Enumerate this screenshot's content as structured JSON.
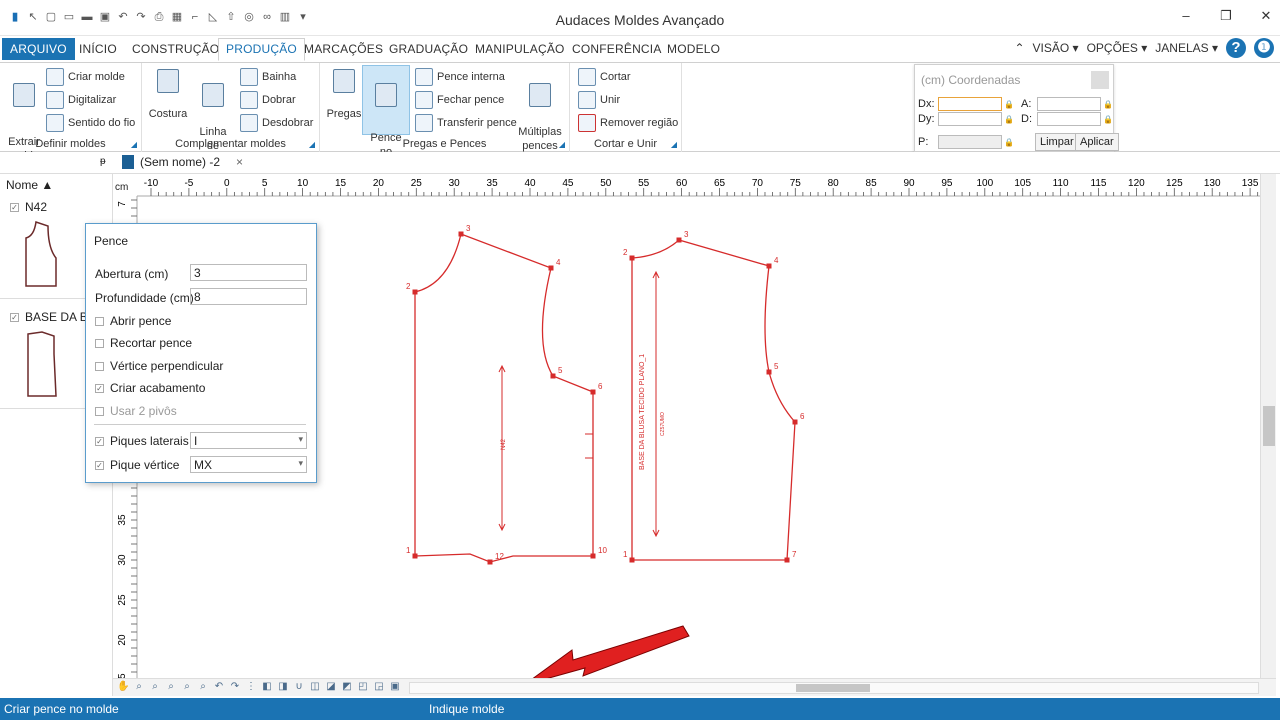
{
  "window": {
    "title": "Audaces Moldes Avançado"
  },
  "menu": {
    "file": "ARQUIVO",
    "tabs": [
      "INÍCIO",
      "CONSTRUÇÃO",
      "PRODUÇÃO",
      "MARCAÇÕES",
      "GRADUAÇÃO",
      "MANIPULAÇÃO",
      "CONFERÊNCIA",
      "MODELO"
    ],
    "active_tab": "PRODUÇÃO",
    "right": {
      "visao": "VISÃO",
      "opcoes": "OPÇÕES",
      "janelas": "JANELAS"
    }
  },
  "ribbon": {
    "definir": {
      "label": "Definir moldes",
      "extrair": "Extrair\nmolde",
      "criar": "Criar molde",
      "digitalizar": "Digitalizar",
      "sentido": "Sentido do fio"
    },
    "complementar": {
      "label": "Complementar moldes",
      "costura": "Costura",
      "simetria": "Linha de\nsimetria",
      "bainha": "Bainha",
      "dobrar": "Dobrar",
      "desdobrar": "Desdobrar"
    },
    "pregas": {
      "label": "Pregas e Pences",
      "pregas": "Pregas",
      "pence_contorno": "Pence no\ncontorno",
      "pence_interna": "Pence interna",
      "fechar": "Fechar pence",
      "transferir": "Transferir pence",
      "multiplas": "Múltiplas\npences"
    },
    "cortar": {
      "label": "Cortar e Unir",
      "cortar": "Cortar",
      "unir": "Unir",
      "remover": "Remover região"
    }
  },
  "coords": {
    "title": "(cm) Coordenadas",
    "dx": "Dx:",
    "dy": "Dy:",
    "a": "A:",
    "d": "D:",
    "p": "P:",
    "limpar": "Limpar",
    "aplicar": "Aplicar"
  },
  "document": {
    "tab": "(Sem nome) -2",
    "pin": "ᵽ",
    "close": "×"
  },
  "left_panel": {
    "header": "Nome",
    "items": [
      {
        "name": "N42"
      },
      {
        "name": "BASE DA B"
      }
    ]
  },
  "ruler": {
    "unit": "cm",
    "h_labels": [
      "-10",
      "-5",
      "0",
      "5",
      "10",
      "15",
      "20",
      "25",
      "30",
      "35",
      "40",
      "45",
      "50",
      "55",
      "60",
      "65",
      "70",
      "75",
      "80",
      "85",
      "90",
      "95",
      "100",
      "105",
      "110",
      "115",
      "120",
      "125",
      "130",
      "135"
    ],
    "v_labels": [
      "7",
      "35",
      "30",
      "25",
      "20",
      "15"
    ]
  },
  "pattern_texts": {
    "front_piece_label": "BASE DA BLUSA TECIDO PLANO_1",
    "front_size": "CZ57UMO",
    "left_size": "N42"
  },
  "pence_dialog": {
    "title": "Pence",
    "abertura_label": "Abertura (cm)",
    "abertura_value": "3",
    "profundidade_label": "Profundidade (cm)",
    "profundidade_value": "8",
    "abrir": "Abrir pence",
    "recortar": "Recortar pence",
    "vertice": "Vértice perpendicular",
    "acabamento": "Criar acabamento",
    "pivos": "Usar 2 pivôs",
    "piques_laterais_label": "Piques laterais",
    "piques_laterais_value": "I",
    "pique_vertice_label": "Pique vértice",
    "pique_vertice_value": "MX"
  },
  "status": {
    "left": "Criar pence no molde",
    "mid": "Indique molde"
  },
  "colors": {
    "accent": "#1b73b3",
    "pattern": "#d62b2b",
    "arrow": "#e02020"
  }
}
